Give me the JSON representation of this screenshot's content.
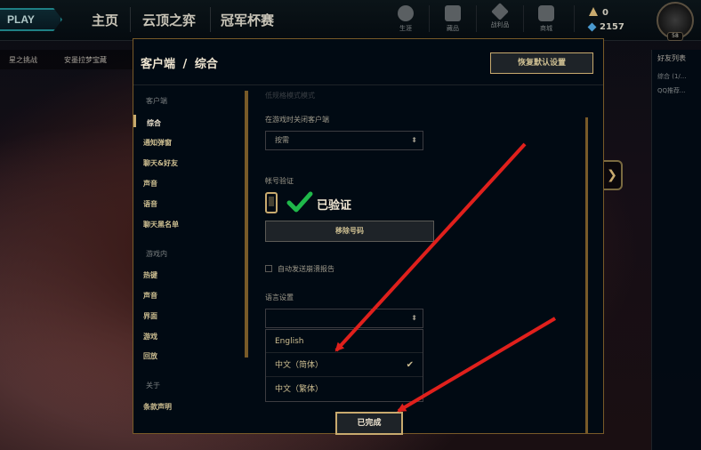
{
  "topnav": {
    "play_label": "PLAY",
    "tabs": [
      {
        "label": "主页"
      },
      {
        "label": "云顶之弈"
      },
      {
        "label": "冠军杯赛"
      }
    ],
    "utilities": [
      {
        "label": "生涯",
        "icon": "profile-icon"
      },
      {
        "label": "藏品",
        "icon": "collection-icon"
      },
      {
        "label": "战利品",
        "icon": "loot-icon"
      },
      {
        "label": "商城",
        "icon": "store-icon"
      }
    ],
    "currency": {
      "rp": "0",
      "be": "2157"
    },
    "avatar_level": "58"
  },
  "subnav": {
    "items": [
      "星之挑战",
      "安墨拉梦宝藏"
    ]
  },
  "friends": {
    "header": "好友列表",
    "groups": [
      "综合 (1/...",
      "QQ推荐..."
    ]
  },
  "modal": {
    "breadcrumb_section": "客户端",
    "breadcrumb_sep": "/",
    "breadcrumb_page": "综合",
    "reset_label": "恢复默认设置",
    "done_label": "已完成"
  },
  "settings_nav": {
    "group_client": "客户端",
    "client_items": [
      "综合",
      "通知弹窗",
      "聊天&好友",
      "声音",
      "语音",
      "聊天黑名单"
    ],
    "group_ingame": "游戏内",
    "ingame_items": [
      "热键",
      "声音",
      "界面",
      "游戏",
      "回放"
    ],
    "group_about": "关于",
    "about_items": [
      "条款声明"
    ]
  },
  "content": {
    "faded_text": "低规格模式模式",
    "close_client_label": "在游戏时关闭客户端",
    "close_client_value": "按需",
    "account_verify_label": "帐号验证",
    "verified_text": "已验证",
    "remove_number_label": "移除号码",
    "auto_send_label": "自动发送崩溃报告",
    "language_label": "语言设置",
    "language_options": [
      {
        "label": "English",
        "selected": false
      },
      {
        "label": "中文（简体）",
        "selected": true
      },
      {
        "label": "中文（繁体）",
        "selected": false
      }
    ]
  },
  "colors": {
    "gold": "#c8aa6e",
    "annotation_red": "#e0201c",
    "check_green": "#1fb84a"
  }
}
